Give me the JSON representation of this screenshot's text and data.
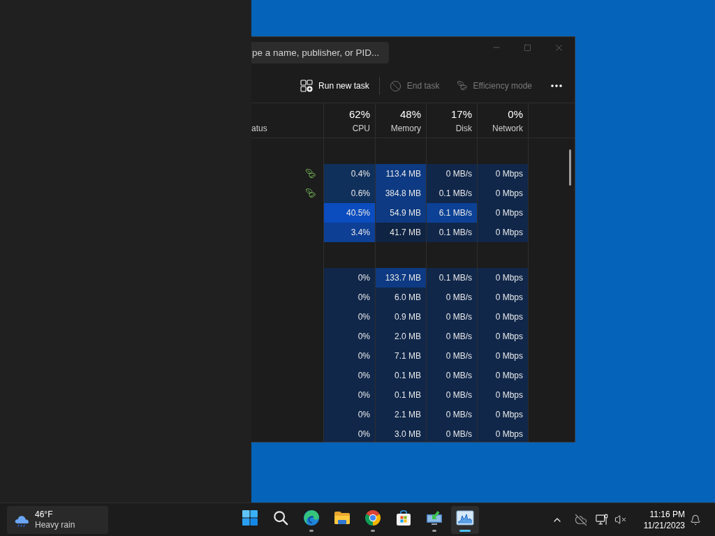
{
  "window": {
    "search": {
      "placeholder": "pe a name, publisher, or PID..."
    }
  },
  "toolbar": {
    "actions": [
      {
        "kind": "run",
        "label": "Run new task",
        "disabled": false
      },
      {
        "kind": "end",
        "label": "End task",
        "disabled": true
      },
      {
        "kind": "efficiency",
        "label": "Efficiency mode",
        "disabled": true
      }
    ]
  },
  "table": {
    "columns": [
      {
        "kind": "status",
        "label": "atus"
      },
      {
        "kind": "metric",
        "percent": "62%",
        "label": "CPU"
      },
      {
        "kind": "metric",
        "percent": "48%",
        "label": "Memory"
      },
      {
        "kind": "metric",
        "percent": "17%",
        "label": "Disk"
      },
      {
        "kind": "metric",
        "percent": "0%",
        "label": "Network"
      }
    ],
    "groups": [
      {
        "rows": [
          {
            "efficiency_mode": true,
            "cells": [
              {
                "text": "0.4%",
                "color": "#10305c"
              },
              {
                "text": "113.4 MB",
                "color": "#0d3a82"
              },
              {
                "text": "0 MB/s",
                "color": "#10274a"
              },
              {
                "text": "0 Mbps",
                "color": "#10274a"
              }
            ]
          },
          {
            "efficiency_mode": true,
            "cells": [
              {
                "text": "0.6%",
                "color": "#10305c"
              },
              {
                "text": "384.8 MB",
                "color": "#0d3a82"
              },
              {
                "text": "0.1 MB/s",
                "color": "#10274a"
              },
              {
                "text": "0 Mbps",
                "color": "#10274a"
              }
            ]
          },
          {
            "efficiency_mode": false,
            "cells": [
              {
                "text": "40.5%",
                "color": "#0b4cbf"
              },
              {
                "text": "54.9 MB",
                "color": "#0d3a82"
              },
              {
                "text": "6.1 MB/s",
                "color": "#0c4196"
              },
              {
                "text": "0 Mbps",
                "color": "#10274a"
              }
            ]
          },
          {
            "efficiency_mode": false,
            "cells": [
              {
                "text": "3.4%",
                "color": "#0d3f95"
              },
              {
                "text": "41.7 MB",
                "color": "#0f2443"
              },
              {
                "text": "0.1 MB/s",
                "color": "#10274a"
              },
              {
                "text": "0 Mbps",
                "color": "#10274a"
              }
            ]
          }
        ]
      },
      {
        "rows": [
          {
            "efficiency_mode": false,
            "cells": [
              {
                "text": "0%",
                "color": "#10274a"
              },
              {
                "text": "133.7 MB",
                "color": "#0d3a82"
              },
              {
                "text": "0.1 MB/s",
                "color": "#10274a"
              },
              {
                "text": "0 Mbps",
                "color": "#10274a"
              }
            ]
          },
          {
            "efficiency_mode": false,
            "cells": [
              {
                "text": "0%",
                "color": "#10274a"
              },
              {
                "text": "6.0 MB",
                "color": "#10274a"
              },
              {
                "text": "0 MB/s",
                "color": "#10274a"
              },
              {
                "text": "0 Mbps",
                "color": "#10274a"
              }
            ]
          },
          {
            "efficiency_mode": false,
            "cells": [
              {
                "text": "0%",
                "color": "#10274a"
              },
              {
                "text": "0.9 MB",
                "color": "#10274a"
              },
              {
                "text": "0 MB/s",
                "color": "#10274a"
              },
              {
                "text": "0 Mbps",
                "color": "#10274a"
              }
            ]
          },
          {
            "efficiency_mode": false,
            "cells": [
              {
                "text": "0%",
                "color": "#10274a"
              },
              {
                "text": "2.0 MB",
                "color": "#10274a"
              },
              {
                "text": "0 MB/s",
                "color": "#10274a"
              },
              {
                "text": "0 Mbps",
                "color": "#10274a"
              }
            ]
          },
          {
            "efficiency_mode": false,
            "cells": [
              {
                "text": "0%",
                "color": "#10274a"
              },
              {
                "text": "7.1 MB",
                "color": "#10274a"
              },
              {
                "text": "0 MB/s",
                "color": "#10274a"
              },
              {
                "text": "0 Mbps",
                "color": "#10274a"
              }
            ]
          },
          {
            "efficiency_mode": false,
            "cells": [
              {
                "text": "0%",
                "color": "#10274a"
              },
              {
                "text": "0.1 MB",
                "color": "#10274a"
              },
              {
                "text": "0 MB/s",
                "color": "#10274a"
              },
              {
                "text": "0 Mbps",
                "color": "#10274a"
              }
            ]
          },
          {
            "efficiency_mode": false,
            "cells": [
              {
                "text": "0%",
                "color": "#10274a"
              },
              {
                "text": "0.1 MB",
                "color": "#10274a"
              },
              {
                "text": "0 MB/s",
                "color": "#10274a"
              },
              {
                "text": "0 Mbps",
                "color": "#10274a"
              }
            ]
          },
          {
            "efficiency_mode": false,
            "cells": [
              {
                "text": "0%",
                "color": "#10274a"
              },
              {
                "text": "2.1 MB",
                "color": "#10274a"
              },
              {
                "text": "0 MB/s",
                "color": "#10274a"
              },
              {
                "text": "0 Mbps",
                "color": "#10274a"
              }
            ]
          },
          {
            "efficiency_mode": false,
            "cells": [
              {
                "text": "0%",
                "color": "#10274a"
              },
              {
                "text": "3.0 MB",
                "color": "#10274a"
              },
              {
                "text": "0 MB/s",
                "color": "#10274a"
              },
              {
                "text": "0 Mbps",
                "color": "#10274a"
              }
            ]
          }
        ]
      }
    ]
  },
  "taskbar": {
    "weather": {
      "temperature": "46°F",
      "condition": "Heavy rain"
    },
    "apps": [
      {
        "kind": "start",
        "running": false,
        "active": false
      },
      {
        "kind": "search",
        "running": false,
        "active": false
      },
      {
        "kind": "edge",
        "running": true,
        "active": false
      },
      {
        "kind": "explorer",
        "running": false,
        "active": false
      },
      {
        "kind": "chrome",
        "running": true,
        "active": false
      },
      {
        "kind": "store",
        "running": false,
        "active": false
      },
      {
        "kind": "monitor",
        "running": true,
        "active": false
      },
      {
        "kind": "taskmanager",
        "running": true,
        "active": true
      }
    ],
    "clock": {
      "time": "11:16 PM",
      "date": "11/21/2023"
    }
  }
}
